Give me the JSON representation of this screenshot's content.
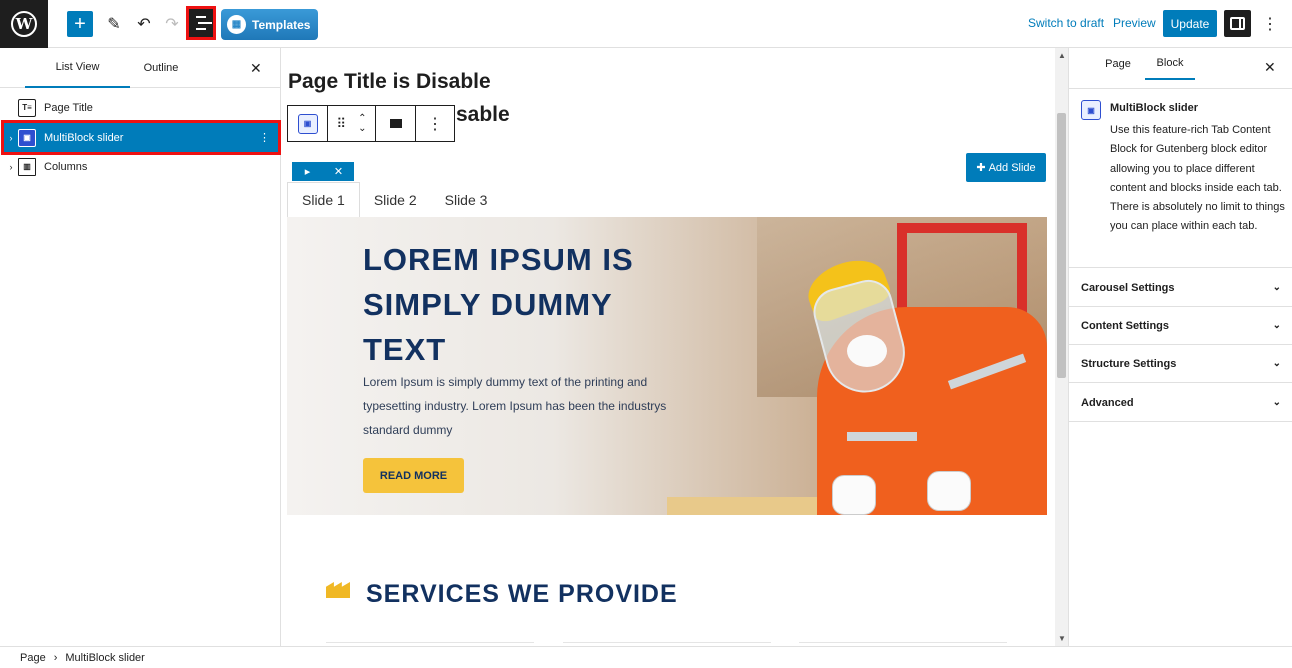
{
  "topbar": {
    "add_label": "+",
    "templates_label": "Templates",
    "switch_draft": "Switch to draft",
    "preview": "Preview",
    "update": "Update"
  },
  "left_panel": {
    "tabs": [
      "List View",
      "Outline"
    ],
    "items": [
      {
        "label": "Page Title",
        "icon": "title-block-icon",
        "selected": false
      },
      {
        "label": "MultiBlock slider",
        "icon": "multiblock-slider-icon",
        "selected": true
      },
      {
        "label": "Columns",
        "icon": "columns-icon",
        "selected": false
      }
    ]
  },
  "canvas": {
    "page_title": "Page Title is Disable",
    "page_title_partial": "sable",
    "add_slide": "Add Slide",
    "slide_tabs": [
      "Slide 1",
      "Slide 2",
      "Slide 3"
    ],
    "active_slide": 0,
    "hero": {
      "heading": "LOREM IPSUM IS SIMPLY DUMMY TEXT",
      "text": "Lorem Ipsum is simply dummy text of the printing and typesetting industry. Lorem Ipsum has been the industrys standard dummy",
      "button": "READ MORE"
    },
    "services_title": "SERVICES WE PROVIDE"
  },
  "right_panel": {
    "tabs": [
      "Page",
      "Block"
    ],
    "active_tab": "Block",
    "block_name": "MultiBlock slider",
    "block_desc": "Use this feature-rich Tab Content Block for Gutenberg block editor allowing you to place different content and blocks inside each tab. There is absolutely no limit to things you can place within each tab.",
    "sections": [
      "Carousel Settings",
      "Content Settings",
      "Structure Settings",
      "Advanced"
    ]
  },
  "breadcrumb": [
    "Page",
    "MultiBlock slider"
  ],
  "colors": {
    "accent": "#007cba",
    "hero_heading": "#123160",
    "button": "#f5c33b",
    "highlight": "#ee1111"
  }
}
